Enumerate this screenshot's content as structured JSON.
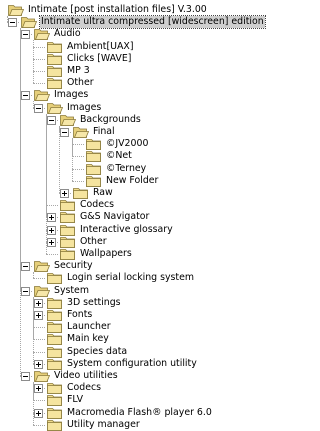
{
  "tree": [
    {
      "label": "Intimate [post installation files] V.3.00",
      "expanded": true
    },
    {
      "label": "Intimate ultra compressed [widescreen] edition",
      "expanded": true,
      "selected": true
    },
    {
      "label": "Audio",
      "expanded": true
    },
    {
      "label": "Ambient[UAX]"
    },
    {
      "label": "Clicks [WAVE]"
    },
    {
      "label": "MP 3"
    },
    {
      "label": "Other"
    },
    {
      "label": "Images",
      "expanded": true
    },
    {
      "label": "Images",
      "expanded": true
    },
    {
      "label": "Backgrounds",
      "expanded": true
    },
    {
      "label": "Final",
      "expanded": true
    },
    {
      "label": "©JV2000"
    },
    {
      "label": "©Net"
    },
    {
      "label": "©Terney"
    },
    {
      "label": "New Folder"
    },
    {
      "label": "Raw",
      "expanded": false
    },
    {
      "label": "Codecs"
    },
    {
      "label": "G&S Navigator",
      "expanded": false
    },
    {
      "label": "Interactive glossary",
      "expanded": false
    },
    {
      "label": "Other",
      "expanded": false
    },
    {
      "label": "Wallpapers"
    },
    {
      "label": "Security",
      "expanded": true
    },
    {
      "label": "Login serial locking system"
    },
    {
      "label": "System",
      "expanded": true
    },
    {
      "label": "3D settings",
      "expanded": false
    },
    {
      "label": "Fonts",
      "expanded": false
    },
    {
      "label": "Launcher"
    },
    {
      "label": "Main key"
    },
    {
      "label": "Species data"
    },
    {
      "label": "System configuration utility",
      "expanded": false
    },
    {
      "label": "Video utilities",
      "expanded": true
    },
    {
      "label": "Codecs",
      "expanded": false
    },
    {
      "label": "FLV"
    },
    {
      "label": "Macromedia Flash® player 6.0",
      "expanded": false
    },
    {
      "label": "Utility manager"
    }
  ]
}
